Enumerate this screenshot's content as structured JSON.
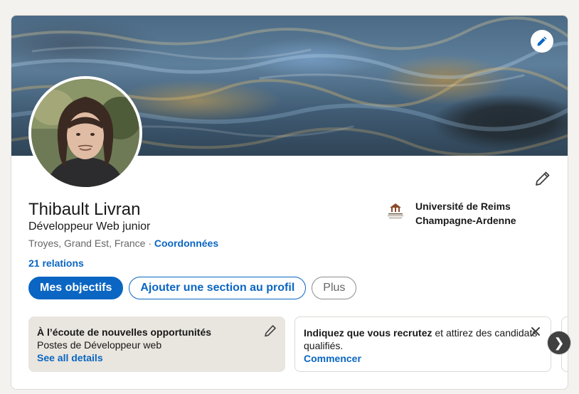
{
  "profile": {
    "name": "Thibault Livran",
    "headline": "Développeur Web junior",
    "location": "Troyes, Grand Est, France",
    "separator": " · ",
    "contact_link": "Coordonnées",
    "connections": "21 relations"
  },
  "education": {
    "school_line1": "Université de Reims",
    "school_line2": "Champagne-Ardenne"
  },
  "actions": {
    "primary": "Mes objectifs",
    "add_section": "Ajouter une section au profil",
    "more": "Plus"
  },
  "open_to_work": {
    "title": "À l’écoute de nouvelles opportunités",
    "subtitle": "Postes de Développeur web",
    "link": "See all details"
  },
  "hiring": {
    "bold_text": "Indiquez que vous recrutez",
    "rest_text": " et attirez des candidats qualifiés.",
    "link": "Commencer"
  },
  "icons": {
    "cover_edit": "pencil-icon",
    "intro_edit": "pencil-icon",
    "panel_edit": "pencil-icon",
    "panel_close": "close-icon",
    "carousel_next": "chevron-right-icon"
  },
  "carousel_next_glyph": "❯",
  "colors": {
    "accent": "#0a66c2",
    "page_bg": "#f4f2ee",
    "panel_bg": "#e9e5df"
  }
}
